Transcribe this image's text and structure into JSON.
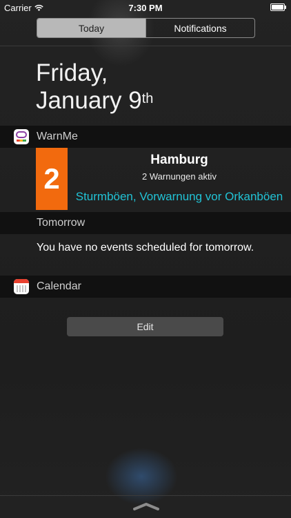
{
  "status_bar": {
    "carrier": "Carrier",
    "time": "7:30 PM"
  },
  "tabs": {
    "today": "Today",
    "notifications": "Notifications",
    "active": "Today"
  },
  "date": {
    "line1": "Friday,",
    "line2": "January 9",
    "suffix": "th"
  },
  "warnme": {
    "section_title": "WarnMe",
    "icon": "warnme-app-icon",
    "level": "2",
    "level_color": "#f26a0e",
    "city": "Hamburg",
    "count_text": "2 Warnungen aktiv",
    "warning_text": "Sturmböen, Vorwarnung vor Orkanböen",
    "warning_color": "#21c3d6"
  },
  "tomorrow": {
    "section_title": "Tomorrow",
    "message": "You have no events scheduled for tomorrow."
  },
  "calendar": {
    "section_title": "Calendar",
    "icon": "calendar-app-icon"
  },
  "edit": {
    "label": "Edit"
  },
  "grabber_icon": "chevron-up-icon"
}
